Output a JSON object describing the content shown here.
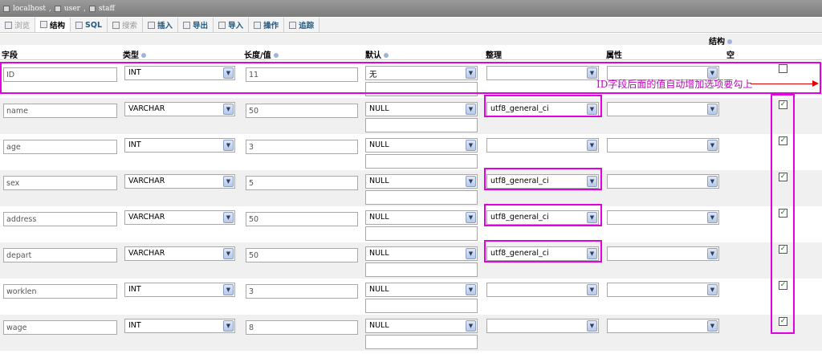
{
  "breadcrumb": {
    "server": "localhost",
    "database": "user",
    "table": "staff",
    "separator": ","
  },
  "tabs": [
    {
      "label": "浏览",
      "icon": "browse-icon",
      "state": "disabled"
    },
    {
      "label": "结构",
      "icon": "structure-icon",
      "state": "active"
    },
    {
      "label": "SQL",
      "icon": "sql-icon",
      "state": "normal"
    },
    {
      "label": "搜索",
      "icon": "search-icon",
      "state": "disabled"
    },
    {
      "label": "插入",
      "icon": "insert-icon",
      "state": "normal"
    },
    {
      "label": "导出",
      "icon": "export-icon",
      "state": "normal"
    },
    {
      "label": "导入",
      "icon": "import-icon",
      "state": "normal"
    },
    {
      "label": "操作",
      "icon": "operations-icon",
      "state": "normal"
    },
    {
      "label": "追踪",
      "icon": "tracking-icon",
      "state": "normal"
    }
  ],
  "structure_label": "结构",
  "columns": {
    "field": "字段",
    "type": "类型",
    "length": "长度/值",
    "default": "默认",
    "collation": "整理",
    "attributes": "属性",
    "null": "空"
  },
  "fields": [
    {
      "name": "ID",
      "type": "INT",
      "length": "11",
      "default": "无",
      "collation": "",
      "attributes": "",
      "null_checked": false
    },
    {
      "name": "name",
      "type": "VARCHAR",
      "length": "50",
      "default": "NULL",
      "collation": "utf8_general_ci",
      "attributes": "",
      "null_checked": true
    },
    {
      "name": "age",
      "type": "INT",
      "length": "3",
      "default": "NULL",
      "collation": "",
      "attributes": "",
      "null_checked": true
    },
    {
      "name": "sex",
      "type": "VARCHAR",
      "length": "5",
      "default": "NULL",
      "collation": "utf8_general_ci",
      "attributes": "",
      "null_checked": true
    },
    {
      "name": "address",
      "type": "VARCHAR",
      "length": "50",
      "default": "NULL",
      "collation": "utf8_general_ci",
      "attributes": "",
      "null_checked": true
    },
    {
      "name": "depart",
      "type": "VARCHAR",
      "length": "50",
      "default": "NULL",
      "collation": "utf8_general_ci",
      "attributes": "",
      "null_checked": true
    },
    {
      "name": "worklen",
      "type": "INT",
      "length": "3",
      "default": "NULL",
      "collation": "",
      "attributes": "",
      "null_checked": true
    },
    {
      "name": "wage",
      "type": "INT",
      "length": "8",
      "default": "NULL",
      "collation": "",
      "attributes": "",
      "null_checked": true
    }
  ],
  "annotation": "ID字段后面的值自动增加选项要勾上",
  "colors": {
    "highlight": "#e000e0",
    "arrow": "#e00000",
    "annotation_text": "#c000c0"
  },
  "icons": {
    "dropdown": "chevron-down-icon",
    "checkmark": "✓"
  }
}
